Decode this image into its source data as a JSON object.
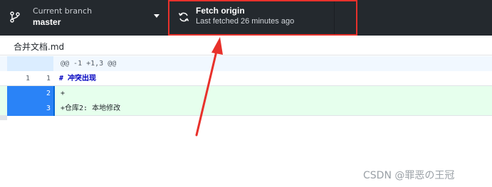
{
  "toolbar": {
    "branch": {
      "caption": "Current branch",
      "name": "master",
      "icon": "git-branch-icon"
    },
    "fetch": {
      "title": "Fetch origin",
      "subtitle": "Last fetched 26 minutes ago",
      "icon": "sync-icon"
    }
  },
  "file": {
    "name": "合并文档.md"
  },
  "diff": {
    "hunk_header": "@@ -1 +1,3 @@",
    "rows": [
      {
        "old": "1",
        "new": "1",
        "text": "# 冲突出现"
      },
      {
        "old": "",
        "new": "2",
        "text": "+"
      },
      {
        "old": "",
        "new": "3",
        "text": "+仓库2: 本地修改"
      }
    ]
  },
  "watermark": "CSDN @罪恶の王冠",
  "colors": {
    "toolbar_bg": "#24292e",
    "annotation_red": "#e8312b",
    "added_bg": "#e6ffed",
    "selected_gutter": "#2a83f7"
  }
}
